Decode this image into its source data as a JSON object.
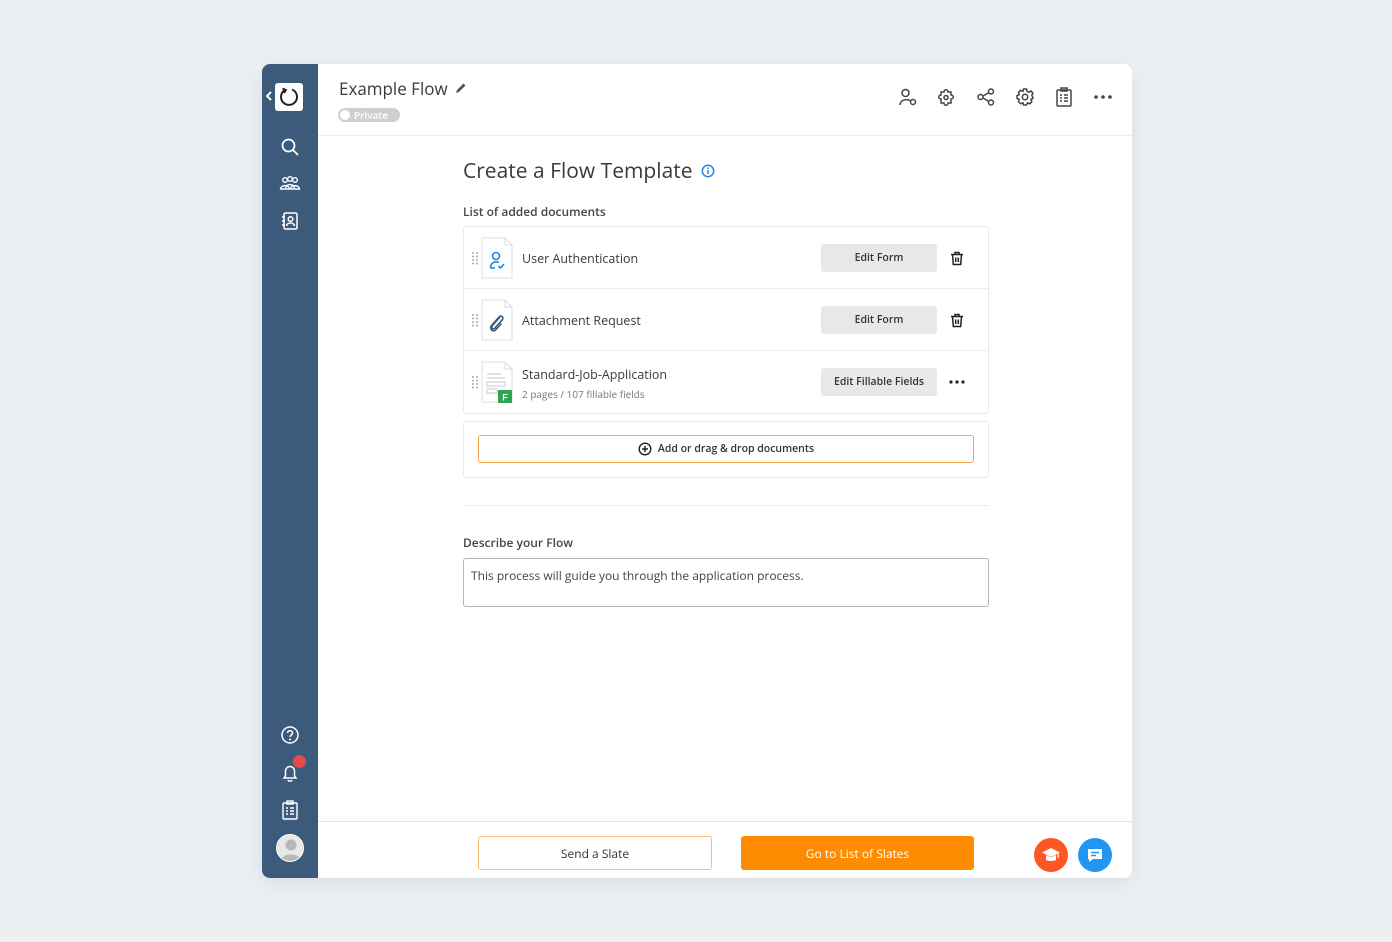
{
  "header": {
    "title": "Example Flow",
    "visibility_label": "Private",
    "toolbar_icons": [
      "user-settings-icon",
      "puzzle-settings-icon",
      "share-icon",
      "gear-icon",
      "clipboard-icon",
      "more-icon"
    ]
  },
  "sidebar": {
    "top_items": [
      "search-icon",
      "groups-icon",
      "contacts-icon"
    ],
    "bottom_items": [
      "help-icon",
      "bell-icon",
      "clipboard-icon",
      "avatar"
    ],
    "has_notification": true
  },
  "main": {
    "page_title": "Create a Flow Template",
    "documents_label": "List of added documents",
    "documents": [
      {
        "name": "User Authentication",
        "subtitle": "",
        "action_label": "Edit Form",
        "thumb_icon": "user-check-icon",
        "row_action": "trash-icon"
      },
      {
        "name": "Attachment Request",
        "subtitle": "",
        "action_label": "Edit Form",
        "thumb_icon": "paperclip-icon",
        "row_action": "trash-icon"
      },
      {
        "name": "Standard-Job-Application",
        "subtitle": "2 pages / 107 fillable fields",
        "action_label": "Edit Fillable Fields",
        "thumb_icon": "fillable-form-icon",
        "badge": "F",
        "row_action": "more-icon"
      }
    ],
    "add_documents_label": "Add or drag & drop documents",
    "description_label": "Describe your Flow",
    "description_value": "This process will guide you through the application process."
  },
  "footer": {
    "send_label": "Send a Slate",
    "go_label": "Go to List of Slates"
  },
  "colors": {
    "sidebar": "#3c5a7c",
    "primary": "#ff8c00",
    "info": "#1e88e5",
    "fab_learn": "#ff5722",
    "fab_chat": "#2196f3",
    "badge_green": "#2ea44f",
    "notification": "#e5484d"
  }
}
